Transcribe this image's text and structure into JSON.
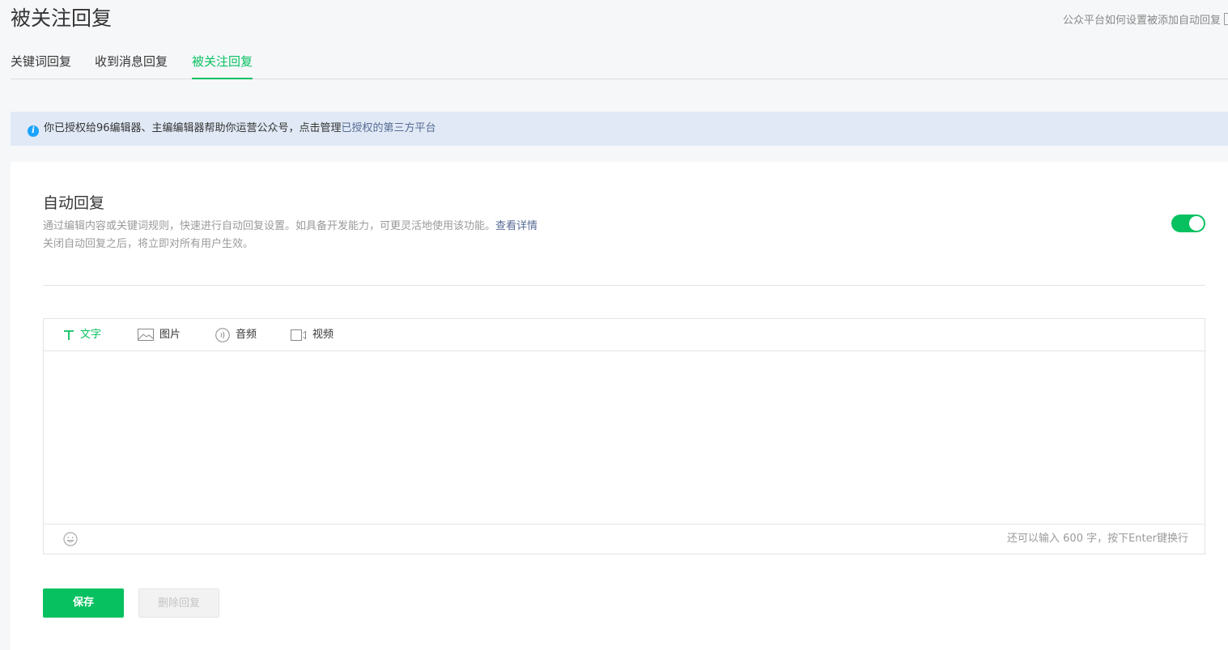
{
  "header": {
    "title": "被关注回复",
    "help_link": "公众平台如何设置被添加自动回复"
  },
  "tabs": [
    {
      "label": "关键词回复",
      "active": false
    },
    {
      "label": "收到消息回复",
      "active": false
    },
    {
      "label": "被关注回复",
      "active": true
    }
  ],
  "notice": {
    "text": "你已授权给96编辑器、主编编辑器帮助你运营公众号，点击管理",
    "link": "已授权的第三方平台"
  },
  "auto_reply": {
    "title": "自动回复",
    "desc_line1": "通过编辑内容或关键词规则，快速进行自动回复设置。如具备开发能力，可更灵活地使用该功能。",
    "desc_link": "查看详情",
    "desc_line2": "关闭自动回复之后，将立即对所有用户生效。",
    "enabled": true
  },
  "editor": {
    "tabs": [
      {
        "label": "文字",
        "icon": "text-icon",
        "active": true
      },
      {
        "label": "图片",
        "icon": "image-icon",
        "active": false
      },
      {
        "label": "音频",
        "icon": "audio-icon",
        "active": false
      },
      {
        "label": "视频",
        "icon": "video-icon",
        "active": false
      }
    ],
    "value": "",
    "counter": "还可以输入 600 字，按下Enter键换行"
  },
  "actions": {
    "save_label": "保存",
    "delete_label": "删除回复"
  },
  "colors": {
    "accent": "#07c160",
    "link": "#576b95",
    "info": "#1aa3ff"
  }
}
